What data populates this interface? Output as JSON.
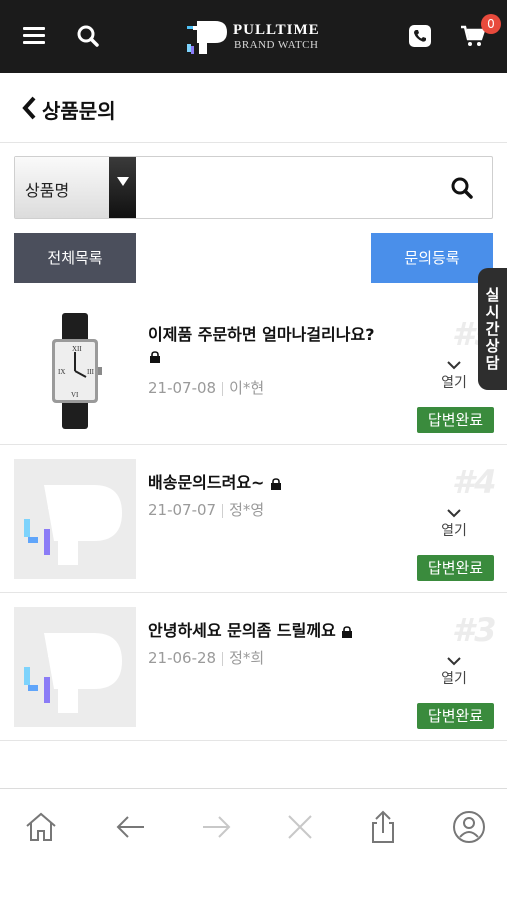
{
  "header": {
    "logo_line1": "PULLTIME",
    "logo_line2": "BRAND WATCH",
    "cart_count": "0",
    "icons": [
      "menu-icon",
      "search-icon",
      "phone-icon",
      "cart-icon"
    ],
    "bg_color": "#1b1b1b"
  },
  "page": {
    "title": "상품문의"
  },
  "search": {
    "select_value": "상품명",
    "placeholder": ""
  },
  "buttons": {
    "all_list": "전체목록",
    "register": "문의등록"
  },
  "realtime_tab": "실시간상담",
  "items": [
    {
      "title": "이제품 주문하면 얼마나걸리나요?",
      "date": "21-07-08",
      "author": "이*현",
      "number": "#5",
      "open_label": "열기",
      "status": "답변완료",
      "thumb": "watch"
    },
    {
      "title": "배송문의드려요~",
      "date": "21-07-07",
      "author": "정*영",
      "number": "#4",
      "open_label": "열기",
      "status": "답변완료",
      "thumb": "logo"
    },
    {
      "title": "안녕하세요 문의좀 드릴께요",
      "date": "21-06-28",
      "author": "정*희",
      "number": "#3",
      "open_label": "열기",
      "status": "답변완료",
      "thumb": "logo"
    }
  ],
  "colors": {
    "badge": "#3a8b3d",
    "register": "#4a8fea",
    "all_list": "#4b4f5c"
  },
  "bottom_nav": [
    "home-icon",
    "back-arrow-icon",
    "forward-arrow-icon",
    "close-icon",
    "share-icon",
    "account-icon"
  ]
}
